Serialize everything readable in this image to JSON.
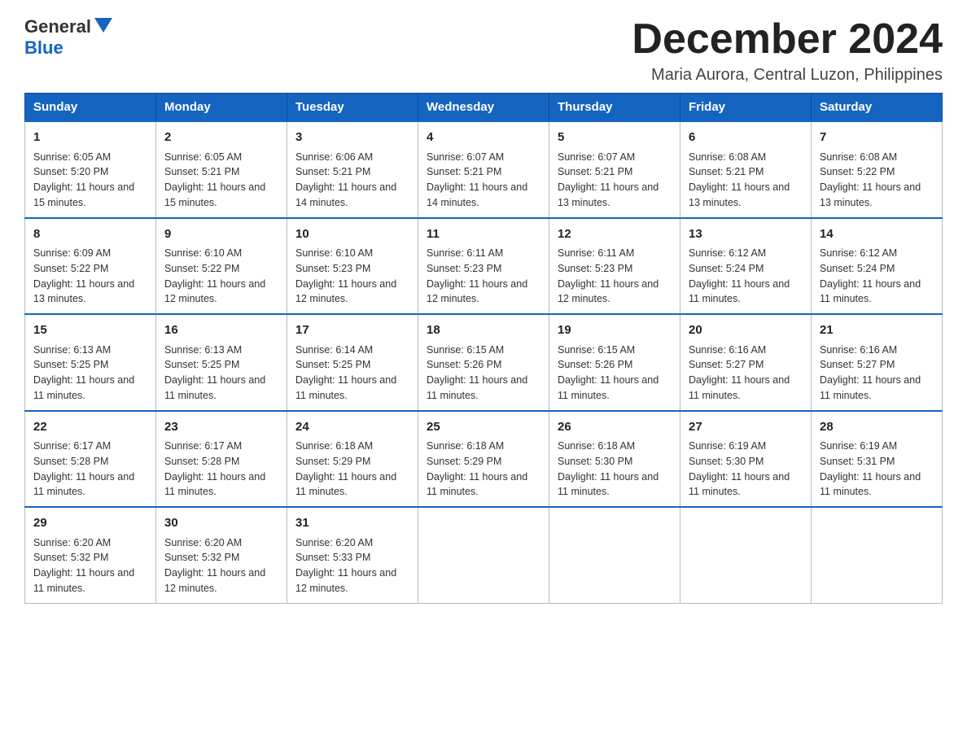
{
  "logo": {
    "text_general": "General",
    "text_blue": "Blue",
    "alt": "GeneralBlue logo"
  },
  "header": {
    "month_title": "December 2024",
    "subtitle": "Maria Aurora, Central Luzon, Philippines"
  },
  "days_of_week": [
    "Sunday",
    "Monday",
    "Tuesday",
    "Wednesday",
    "Thursday",
    "Friday",
    "Saturday"
  ],
  "weeks": [
    [
      {
        "day": "1",
        "sunrise": "6:05 AM",
        "sunset": "5:20 PM",
        "daylight": "11 hours and 15 minutes."
      },
      {
        "day": "2",
        "sunrise": "6:05 AM",
        "sunset": "5:21 PM",
        "daylight": "11 hours and 15 minutes."
      },
      {
        "day": "3",
        "sunrise": "6:06 AM",
        "sunset": "5:21 PM",
        "daylight": "11 hours and 14 minutes."
      },
      {
        "day": "4",
        "sunrise": "6:07 AM",
        "sunset": "5:21 PM",
        "daylight": "11 hours and 14 minutes."
      },
      {
        "day": "5",
        "sunrise": "6:07 AM",
        "sunset": "5:21 PM",
        "daylight": "11 hours and 13 minutes."
      },
      {
        "day": "6",
        "sunrise": "6:08 AM",
        "sunset": "5:21 PM",
        "daylight": "11 hours and 13 minutes."
      },
      {
        "day": "7",
        "sunrise": "6:08 AM",
        "sunset": "5:22 PM",
        "daylight": "11 hours and 13 minutes."
      }
    ],
    [
      {
        "day": "8",
        "sunrise": "6:09 AM",
        "sunset": "5:22 PM",
        "daylight": "11 hours and 13 minutes."
      },
      {
        "day": "9",
        "sunrise": "6:10 AM",
        "sunset": "5:22 PM",
        "daylight": "11 hours and 12 minutes."
      },
      {
        "day": "10",
        "sunrise": "6:10 AM",
        "sunset": "5:23 PM",
        "daylight": "11 hours and 12 minutes."
      },
      {
        "day": "11",
        "sunrise": "6:11 AM",
        "sunset": "5:23 PM",
        "daylight": "11 hours and 12 minutes."
      },
      {
        "day": "12",
        "sunrise": "6:11 AM",
        "sunset": "5:23 PM",
        "daylight": "11 hours and 12 minutes."
      },
      {
        "day": "13",
        "sunrise": "6:12 AM",
        "sunset": "5:24 PM",
        "daylight": "11 hours and 11 minutes."
      },
      {
        "day": "14",
        "sunrise": "6:12 AM",
        "sunset": "5:24 PM",
        "daylight": "11 hours and 11 minutes."
      }
    ],
    [
      {
        "day": "15",
        "sunrise": "6:13 AM",
        "sunset": "5:25 PM",
        "daylight": "11 hours and 11 minutes."
      },
      {
        "day": "16",
        "sunrise": "6:13 AM",
        "sunset": "5:25 PM",
        "daylight": "11 hours and 11 minutes."
      },
      {
        "day": "17",
        "sunrise": "6:14 AM",
        "sunset": "5:25 PM",
        "daylight": "11 hours and 11 minutes."
      },
      {
        "day": "18",
        "sunrise": "6:15 AM",
        "sunset": "5:26 PM",
        "daylight": "11 hours and 11 minutes."
      },
      {
        "day": "19",
        "sunrise": "6:15 AM",
        "sunset": "5:26 PM",
        "daylight": "11 hours and 11 minutes."
      },
      {
        "day": "20",
        "sunrise": "6:16 AM",
        "sunset": "5:27 PM",
        "daylight": "11 hours and 11 minutes."
      },
      {
        "day": "21",
        "sunrise": "6:16 AM",
        "sunset": "5:27 PM",
        "daylight": "11 hours and 11 minutes."
      }
    ],
    [
      {
        "day": "22",
        "sunrise": "6:17 AM",
        "sunset": "5:28 PM",
        "daylight": "11 hours and 11 minutes."
      },
      {
        "day": "23",
        "sunrise": "6:17 AM",
        "sunset": "5:28 PM",
        "daylight": "11 hours and 11 minutes."
      },
      {
        "day": "24",
        "sunrise": "6:18 AM",
        "sunset": "5:29 PM",
        "daylight": "11 hours and 11 minutes."
      },
      {
        "day": "25",
        "sunrise": "6:18 AM",
        "sunset": "5:29 PM",
        "daylight": "11 hours and 11 minutes."
      },
      {
        "day": "26",
        "sunrise": "6:18 AM",
        "sunset": "5:30 PM",
        "daylight": "11 hours and 11 minutes."
      },
      {
        "day": "27",
        "sunrise": "6:19 AM",
        "sunset": "5:30 PM",
        "daylight": "11 hours and 11 minutes."
      },
      {
        "day": "28",
        "sunrise": "6:19 AM",
        "sunset": "5:31 PM",
        "daylight": "11 hours and 11 minutes."
      }
    ],
    [
      {
        "day": "29",
        "sunrise": "6:20 AM",
        "sunset": "5:32 PM",
        "daylight": "11 hours and 11 minutes."
      },
      {
        "day": "30",
        "sunrise": "6:20 AM",
        "sunset": "5:32 PM",
        "daylight": "11 hours and 12 minutes."
      },
      {
        "day": "31",
        "sunrise": "6:20 AM",
        "sunset": "5:33 PM",
        "daylight": "11 hours and 12 minutes."
      },
      null,
      null,
      null,
      null
    ]
  ],
  "labels": {
    "sunrise": "Sunrise:",
    "sunset": "Sunset:",
    "daylight": "Daylight:"
  }
}
